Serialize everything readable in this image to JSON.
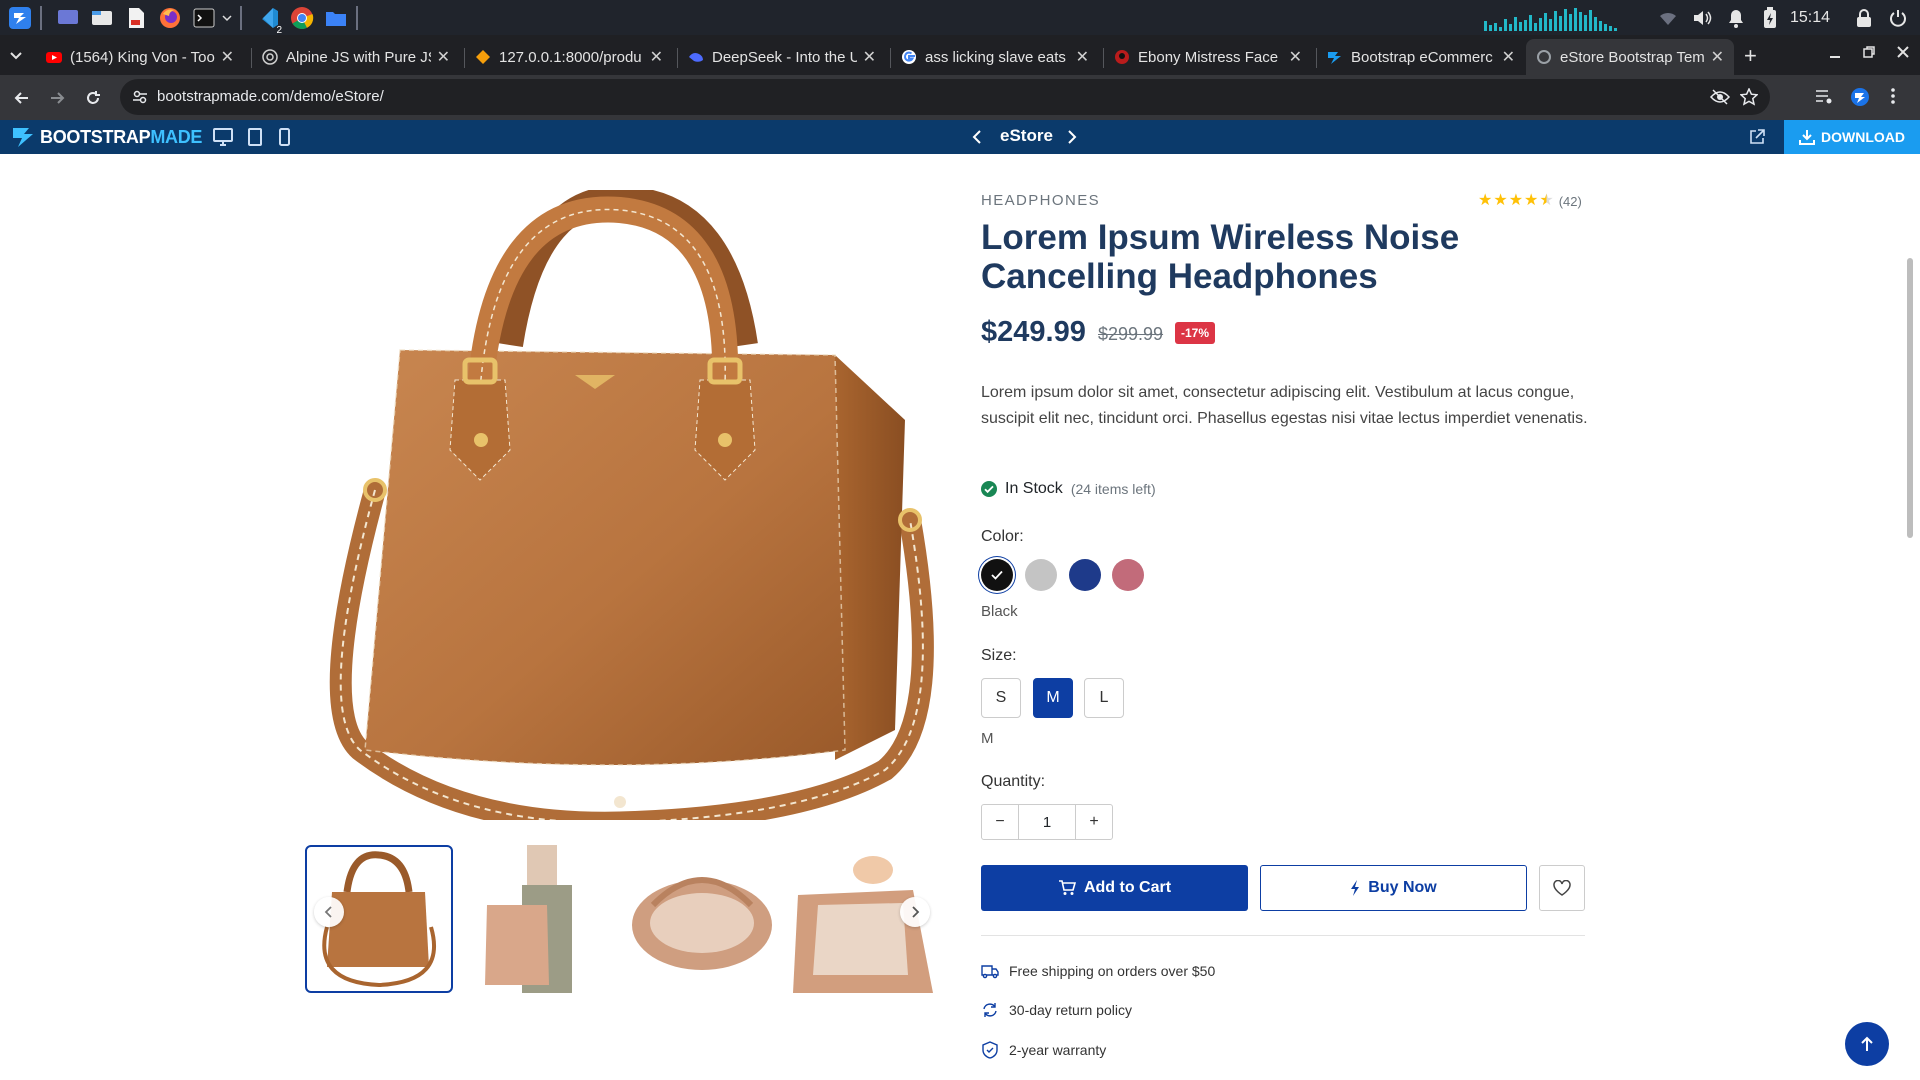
{
  "taskbar": {
    "clock": "15:14",
    "vscode_badge": "2"
  },
  "browser": {
    "tabs": [
      {
        "title": "(1564) King Von - Too",
        "favicon": "youtube",
        "color": "#ff0000"
      },
      {
        "title": "Alpine JS with Pure JS",
        "favicon": "generic",
        "color": "#9aa0a6"
      },
      {
        "title": "127.0.0.1:8000/produ",
        "favicon": "localhost",
        "color": "#f59e0b"
      },
      {
        "title": "DeepSeek - Into the U",
        "favicon": "deepseek",
        "color": "#4d6bfe"
      },
      {
        "title": "ass licking slave eats",
        "favicon": "google",
        "color": "#4285f4"
      },
      {
        "title": "Ebony Mistress Face",
        "favicon": "site",
        "color": "#b91c1c"
      },
      {
        "title": "Bootstrap eCommerc",
        "favicon": "bootstrapmade",
        "color": "#1a9cf0"
      },
      {
        "title": "eStore Bootstrap Tem",
        "favicon": "bootstrapmade",
        "color": "#9aa0a6",
        "active": true
      }
    ],
    "url": "bootstrapmade.com/demo/eStore/"
  },
  "demobar": {
    "logo_main": "BOOTSTRAP",
    "logo_accent": "MADE",
    "title": "eStore",
    "download": "DOWNLOAD"
  },
  "product": {
    "category": "HEADPHONES",
    "rating": 4.5,
    "rating_count": "(42)",
    "title": "Lorem Ipsum Wireless Noise Cancelling Headphones",
    "price": "$249.99",
    "old_price": "$299.99",
    "discount": "-17%",
    "description": "Lorem ipsum dolor sit amet, consectetur adipiscing elit. Vestibulum at lacus congue, suscipit elit nec, tincidunt orci. Phasellus egestas nisi vitae lectus imperdiet venenatis.",
    "stock_status": "In Stock",
    "stock_count": "(24 items left)",
    "color_label": "Color:",
    "colors": [
      "#111111",
      "#c4c4c4",
      "#1e3a8a",
      "#c26b7a"
    ],
    "selected_color": "Black",
    "size_label": "Size:",
    "sizes": [
      "S",
      "M",
      "L"
    ],
    "selected_size": "M",
    "quantity_label": "Quantity:",
    "quantity": "1",
    "add_to_cart": "Add to Cart",
    "buy_now": "Buy Now",
    "features": [
      "Free shipping on orders over $50",
      "30-day return policy",
      "2-year warranty"
    ]
  },
  "colors": {
    "primary": "#0d3ea3",
    "heading": "#1f3a5f",
    "bag": "#b8743f",
    "success": "#198754",
    "danger": "#dc3545"
  }
}
